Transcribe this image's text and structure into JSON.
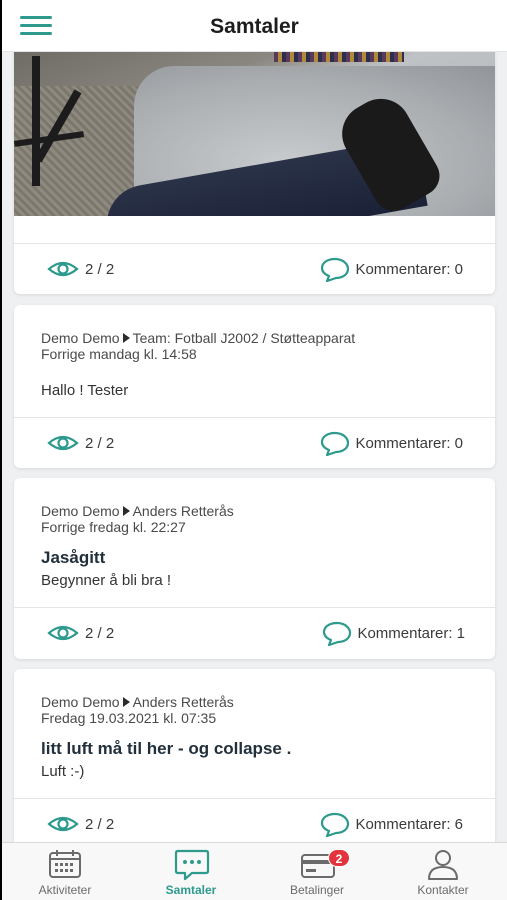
{
  "header": {
    "title": "Samtaler"
  },
  "posts": [
    {
      "views": "2 / 2",
      "comments": "Kommentarer: 0"
    },
    {
      "author": "Demo Demo",
      "target": "Team: Fotball J2002 / Støtteapparat",
      "time": "Forrige mandag kl. 14:58",
      "subject": "",
      "body": "Hallo ! Tester",
      "views": "2 / 2",
      "comments": "Kommentarer: 0"
    },
    {
      "author": "Demo Demo",
      "target": "Anders Retterås",
      "time": "Forrige fredag kl. 22:27",
      "subject": "Jasågitt",
      "body": "Begynner å bli bra !",
      "views": "2 / 2",
      "comments": "Kommentarer: 1"
    },
    {
      "author": "Demo Demo",
      "target": "Anders Retterås",
      "time": "Fredag 19.03.2021 kl. 07:35",
      "subject": "litt luft må til her - og collapse .",
      "body": "Luft :-)",
      "views": "2 / 2",
      "comments": "Kommentarer: 6"
    }
  ],
  "tabbar": {
    "items": [
      {
        "label": "Aktiviteter",
        "icon": "calendar-icon"
      },
      {
        "label": "Samtaler",
        "icon": "chat-icon"
      },
      {
        "label": "Betalinger",
        "icon": "card-icon",
        "badge": "2"
      },
      {
        "label": "Kontakter",
        "icon": "person-icon"
      }
    ],
    "active": "Samtaler"
  },
  "colors": {
    "accent": "#2e9a8e",
    "badge": "#e3343d"
  }
}
